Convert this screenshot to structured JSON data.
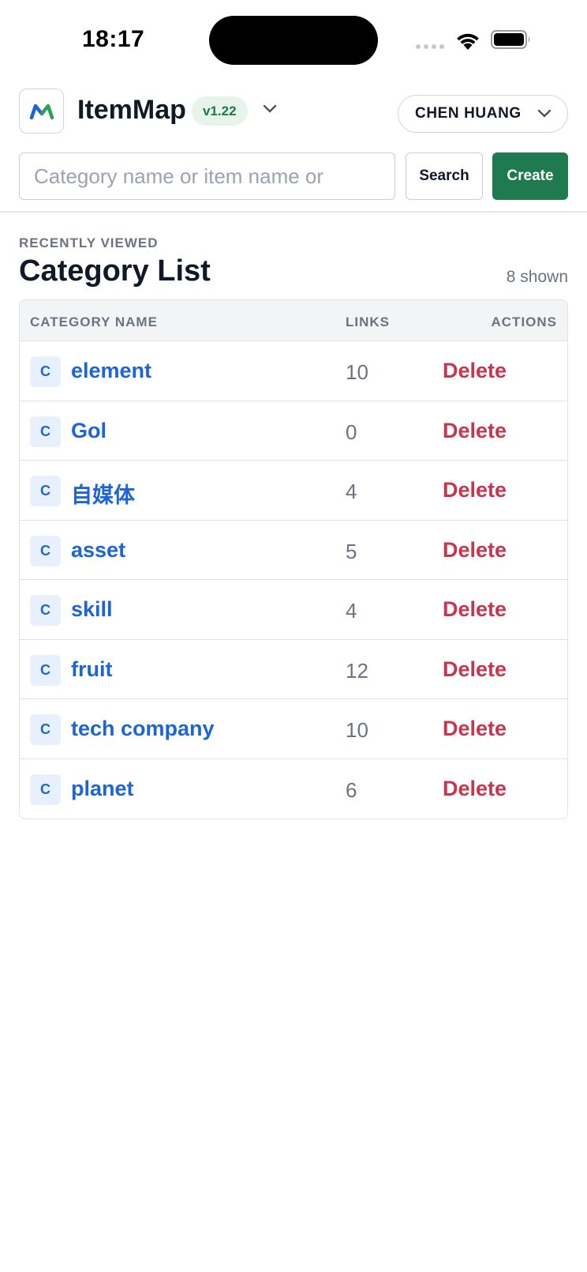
{
  "status_bar": {
    "time": "18:17"
  },
  "header": {
    "logo_icon": "itemmap-logo-icon",
    "app_name": "ItemMap",
    "version": "v1.22",
    "user_name": "CHEN HUANG"
  },
  "search": {
    "placeholder": "Category name or item name or",
    "value": "",
    "search_label": "Search",
    "create_label": "Create"
  },
  "section": {
    "eyebrow": "RECENTLY VIEWED",
    "title": "Category List",
    "count_label": "8 shown"
  },
  "table": {
    "columns": {
      "name": "CATEGORY NAME",
      "links": "LINKS",
      "actions": "ACTIONS"
    },
    "rows": [
      {
        "badge": "C",
        "name": "element",
        "links": "10",
        "action": "Delete"
      },
      {
        "badge": "C",
        "name": "Gol",
        "links": "0",
        "action": "Delete"
      },
      {
        "badge": "C",
        "name": "自媒体",
        "links": "4",
        "action": "Delete"
      },
      {
        "badge": "C",
        "name": "asset",
        "links": "5",
        "action": "Delete"
      },
      {
        "badge": "C",
        "name": "skill",
        "links": "4",
        "action": "Delete"
      },
      {
        "badge": "C",
        "name": "fruit",
        "links": "12",
        "action": "Delete"
      },
      {
        "badge": "C",
        "name": "tech company",
        "links": "10",
        "action": "Delete"
      },
      {
        "badge": "C",
        "name": "planet",
        "links": "6",
        "action": "Delete"
      }
    ]
  },
  "colors": {
    "accent_green": "#1f7a50",
    "link_blue": "#1d64d8",
    "danger_red": "#c8354e",
    "badge_green_bg": "#e6f4ec"
  }
}
